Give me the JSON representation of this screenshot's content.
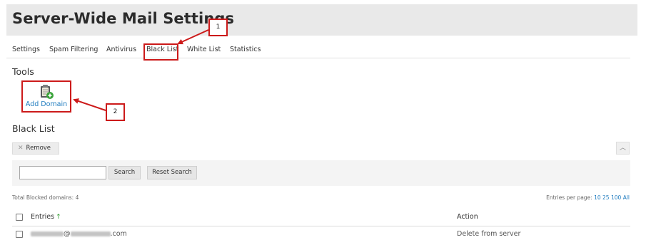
{
  "page": {
    "title": "Server-Wide Mail Settings"
  },
  "tabs": [
    {
      "label": "Settings"
    },
    {
      "label": "Spam Filtering"
    },
    {
      "label": "Antivirus"
    },
    {
      "label": "Black List"
    },
    {
      "label": "White List"
    },
    {
      "label": "Statistics"
    }
  ],
  "tools": {
    "title": "Tools",
    "add_domain_label": "Add Domain",
    "add_domain_icon": "clipboard-add-icon"
  },
  "blacklist": {
    "title": "Black List",
    "remove_label": "Remove",
    "remove_icon": "remove-icon",
    "collapse_icon": "chevron-up-icon",
    "search": {
      "value": "",
      "search_label": "Search",
      "reset_label": "Reset Search"
    },
    "total_label": "Total Blocked domains: 4",
    "entries_per_page_label": "Entries per page:",
    "page_sizes": [
      "10",
      "25",
      "100",
      "All"
    ],
    "columns": {
      "entries": "Entries",
      "action": "Action"
    },
    "rows": [
      {
        "entry_visible": "@",
        "entry_suffix": ".com",
        "action": "Delete from server"
      }
    ]
  },
  "annotations": [
    {
      "label": "1"
    },
    {
      "label": "2"
    }
  ],
  "colors": {
    "link": "#1e7bbf",
    "annotation": "#cc1a1a",
    "header_bg": "#e9e9e9",
    "sort_arrow": "#2e9a2e"
  }
}
